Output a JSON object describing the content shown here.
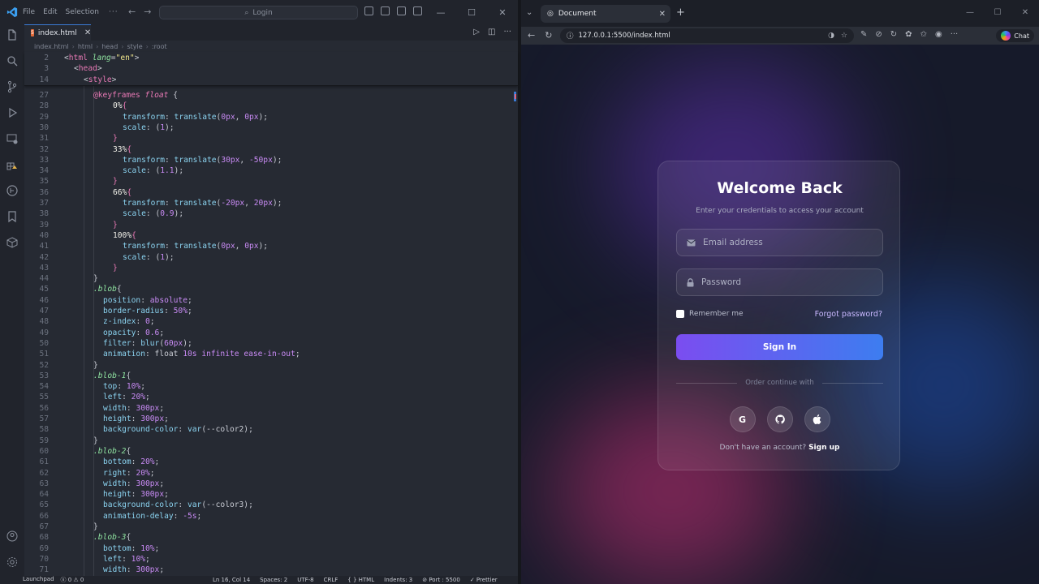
{
  "vscode": {
    "menu": [
      "File",
      "Edit",
      "Selection"
    ],
    "more": "···",
    "search_placeholder": "Login",
    "tab_name": "index.html",
    "breadcrumb": [
      "index.html",
      "html",
      "head",
      "style",
      ":root"
    ],
    "sticky_lines": [
      {
        "n": "2",
        "html": "<span class='c-plain'>&lt;</span><span class='c-tag'>html</span> <span class='c-attr'>lang</span><span class='c-plain'>=</span><span class='c-str'>\"en\"</span><span class='c-plain'>&gt;</span>",
        "indent": 0
      },
      {
        "n": "3",
        "html": "<span class='c-plain'>&lt;</span><span class='c-tag'>head</span><span class='c-plain'>&gt;</span>",
        "indent": 1
      },
      {
        "n": "14",
        "html": "<span class='c-plain'>&lt;</span><span class='c-tag'>style</span><span class='c-plain'>&gt;</span>",
        "indent": 2
      }
    ],
    "lines": [
      {
        "n": "27",
        "html": "<span class='c-kw'>@keyframes</span> <span class='c-it'>float</span> <span class='c-plain'>{</span>",
        "indent": 3
      },
      {
        "n": "28",
        "html": "<span class='c-pct'>0%</span><span class='c-br'>{</span>",
        "indent": 5
      },
      {
        "n": "29",
        "html": "<span class='c-prop'>transform</span><span class='c-plain'>: </span><span class='c-fn'>translate</span><span class='c-plain'>(</span><span class='c-num'>0px</span><span class='c-plain'>, </span><span class='c-num'>0px</span><span class='c-plain'>);</span>",
        "indent": 6
      },
      {
        "n": "30",
        "html": "<span class='c-prop'>scale</span><span class='c-plain'>: (</span><span class='c-num'>1</span><span class='c-plain'>);</span>",
        "indent": 6
      },
      {
        "n": "31",
        "html": "<span class='c-br'>}</span>",
        "indent": 5
      },
      {
        "n": "32",
        "html": "<span class='c-pct'>33%</span><span class='c-br'>{</span>",
        "indent": 5
      },
      {
        "n": "33",
        "html": "<span class='c-prop'>transform</span><span class='c-plain'>: </span><span class='c-fn'>translate</span><span class='c-plain'>(</span><span class='c-num'>30px</span><span class='c-plain'>, </span><span class='c-num'>-50px</span><span class='c-plain'>);</span>",
        "indent": 6
      },
      {
        "n": "34",
        "html": "<span class='c-prop'>scale</span><span class='c-plain'>: (</span><span class='c-num'>1.1</span><span class='c-plain'>);</span>",
        "indent": 6
      },
      {
        "n": "35",
        "html": "<span class='c-br'>}</span>",
        "indent": 5
      },
      {
        "n": "36",
        "html": "<span class='c-pct'>66%</span><span class='c-br'>{</span>",
        "indent": 5
      },
      {
        "n": "37",
        "html": "<span class='c-prop'>transform</span><span class='c-plain'>: </span><span class='c-fn'>translate</span><span class='c-plain'>(</span><span class='c-num'>-20px</span><span class='c-plain'>, </span><span class='c-num'>20px</span><span class='c-plain'>);</span>",
        "indent": 6
      },
      {
        "n": "38",
        "html": "<span class='c-prop'>scale</span><span class='c-plain'>: (</span><span class='c-num'>0.9</span><span class='c-plain'>);</span>",
        "indent": 6
      },
      {
        "n": "39",
        "html": "<span class='c-br'>}</span>",
        "indent": 5
      },
      {
        "n": "40",
        "html": "<span class='c-pct'>100%</span><span class='c-br'>{</span>",
        "indent": 5
      },
      {
        "n": "41",
        "html": "<span class='c-prop'>transform</span><span class='c-plain'>: </span><span class='c-fn'>translate</span><span class='c-plain'>(</span><span class='c-num'>0px</span><span class='c-plain'>, </span><span class='c-num'>0px</span><span class='c-plain'>);</span>",
        "indent": 6
      },
      {
        "n": "42",
        "html": "<span class='c-prop'>scale</span><span class='c-plain'>: (</span><span class='c-num'>1</span><span class='c-plain'>);</span>",
        "indent": 6
      },
      {
        "n": "43",
        "html": "<span class='c-br'>}</span>",
        "indent": 5
      },
      {
        "n": "44",
        "html": "<span class='c-plain'>}</span>",
        "indent": 3
      },
      {
        "n": "45",
        "html": "<span class='c-sel'>.blob</span><span class='c-plain'>{</span>",
        "indent": 3
      },
      {
        "n": "46",
        "html": "<span class='c-prop'>position</span><span class='c-plain'>: </span><span class='c-val'>absolute</span><span class='c-plain'>;</span>",
        "indent": 4
      },
      {
        "n": "47",
        "html": "<span class='c-prop'>border-radius</span><span class='c-plain'>: </span><span class='c-num'>50%</span><span class='c-plain'>;</span>",
        "indent": 4
      },
      {
        "n": "48",
        "html": "<span class='c-prop'>z-index</span><span class='c-plain'>: </span><span class='c-num'>0</span><span class='c-plain'>;</span>",
        "indent": 4
      },
      {
        "n": "49",
        "html": "<span class='c-prop'>opacity</span><span class='c-plain'>: </span><span class='c-num'>0.6</span><span class='c-plain'>;</span>",
        "indent": 4
      },
      {
        "n": "50",
        "html": "<span class='c-prop'>filter</span><span class='c-plain'>: </span><span class='c-fn'>blur</span><span class='c-plain'>(</span><span class='c-num'>60px</span><span class='c-plain'>);</span>",
        "indent": 4
      },
      {
        "n": "51",
        "html": "<span class='c-prop'>animation</span><span class='c-plain'>: float </span><span class='c-num'>10s</span> <span class='c-val'>infinite</span> <span class='c-val'>ease-in-out</span><span class='c-plain'>;</span>",
        "indent": 4
      },
      {
        "n": "52",
        "html": "<span class='c-plain'>}</span>",
        "indent": 3
      },
      {
        "n": "53",
        "html": "<span class='c-sel'>.blob-1</span><span class='c-plain'>{</span>",
        "indent": 3
      },
      {
        "n": "54",
        "html": "<span class='c-prop'>top</span><span class='c-plain'>: </span><span class='c-num'>10%</span><span class='c-plain'>;</span>",
        "indent": 4
      },
      {
        "n": "55",
        "html": "<span class='c-prop'>left</span><span class='c-plain'>: </span><span class='c-num'>20%</span><span class='c-plain'>;</span>",
        "indent": 4
      },
      {
        "n": "56",
        "html": "<span class='c-prop'>width</span><span class='c-plain'>: </span><span class='c-num'>300px</span><span class='c-plain'>;</span>",
        "indent": 4
      },
      {
        "n": "57",
        "html": "<span class='c-prop'>height</span><span class='c-plain'>: </span><span class='c-num'>300px</span><span class='c-plain'>;</span>",
        "indent": 4
      },
      {
        "n": "58",
        "html": "<span class='c-prop'>background-color</span><span class='c-plain'>: </span><span class='c-fn'>var</span><span class='c-plain'>(--color2);</span>",
        "indent": 4
      },
      {
        "n": "59",
        "html": "<span class='c-plain'>}</span>",
        "indent": 3
      },
      {
        "n": "60",
        "html": "<span class='c-sel'>.blob-2</span><span class='c-plain'>{</span>",
        "indent": 3
      },
      {
        "n": "61",
        "html": "<span class='c-prop'>bottom</span><span class='c-plain'>: </span><span class='c-num'>20%</span><span class='c-plain'>;</span>",
        "indent": 4
      },
      {
        "n": "62",
        "html": "<span class='c-prop'>right</span><span class='c-plain'>: </span><span class='c-num'>20%</span><span class='c-plain'>;</span>",
        "indent": 4
      },
      {
        "n": "63",
        "html": "<span class='c-prop'>width</span><span class='c-plain'>: </span><span class='c-num'>300px</span><span class='c-plain'>;</span>",
        "indent": 4
      },
      {
        "n": "64",
        "html": "<span class='c-prop'>height</span><span class='c-plain'>: </span><span class='c-num'>300px</span><span class='c-plain'>;</span>",
        "indent": 4
      },
      {
        "n": "65",
        "html": "<span class='c-prop'>background-color</span><span class='c-plain'>: </span><span class='c-fn'>var</span><span class='c-plain'>(--color3);</span>",
        "indent": 4
      },
      {
        "n": "66",
        "html": "<span class='c-prop'>animation-delay</span><span class='c-plain'>: </span><span class='c-num'>-5s</span><span class='c-plain'>;</span>",
        "indent": 4
      },
      {
        "n": "67",
        "html": "<span class='c-plain'>}</span>",
        "indent": 3
      },
      {
        "n": "68",
        "html": "<span class='c-sel'>.blob-3</span><span class='c-plain'>{</span>",
        "indent": 3
      },
      {
        "n": "69",
        "html": "<span class='c-prop'>bottom</span><span class='c-plain'>: </span><span class='c-num'>10%</span><span class='c-plain'>;</span>",
        "indent": 4
      },
      {
        "n": "70",
        "html": "<span class='c-prop'>left</span><span class='c-plain'>: </span><span class='c-num'>10%</span><span class='c-plain'>;</span>",
        "indent": 4
      },
      {
        "n": "71",
        "html": "<span class='c-prop'>width</span><span class='c-plain'>: </span><span class='c-num'>300px</span><span class='c-plain'>;</span>",
        "indent": 4
      }
    ],
    "status": {
      "launchpad": "Launchpad",
      "problems": "ⓧ 0 ⚠ 0",
      "position": "Ln 16, Col 14",
      "spaces": "Spaces: 2",
      "encoding": "UTF-8",
      "eol": "CRLF",
      "language": "{ } HTML",
      "indents": "Indents: 3",
      "port": "⊘ Port : 5500",
      "prettier": "✓ Prettier"
    }
  },
  "browser": {
    "tab_title": "Document",
    "url": "127.0.0.1:5500/index.html",
    "chat_label": "Chat"
  },
  "login": {
    "title": "Welcome Back",
    "subtitle": "Enter your credentials to access your account",
    "email_placeholder": "Email address",
    "password_placeholder": "Password",
    "remember_label": "Remember me",
    "forgot_label": "Forgot password?",
    "signin_label": "Sign In",
    "divider_text": "Order continue with",
    "social": [
      "G",
      "◉",
      ""
    ],
    "signup_prompt": "Don't have an account?",
    "signup_link": "Sign up"
  },
  "colors": {
    "accent_start": "#7b4df0",
    "accent_end": "#3d7df0",
    "blob_purple": "#4b2a8c",
    "blob_blue": "#1e4fb0",
    "blob_pink": "#9a2a63"
  }
}
